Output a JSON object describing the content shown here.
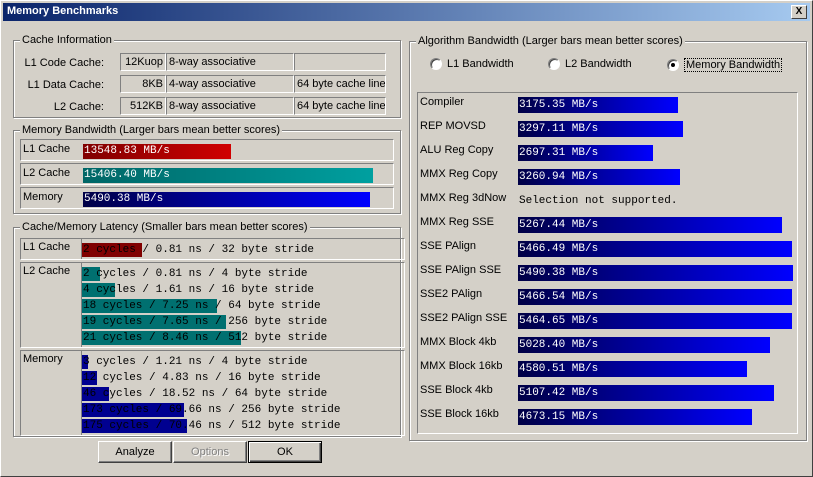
{
  "window": {
    "title": "Memory Benchmarks",
    "close": "X"
  },
  "cache_info": {
    "legend": "Cache Information",
    "rows": [
      {
        "label": "L1 Code Cache:",
        "size": "12Kuop",
        "assoc": "8-way associative",
        "line": ""
      },
      {
        "label": "L1 Data Cache:",
        "size": "8KB",
        "assoc": "4-way associative",
        "line": "64 byte cache line"
      },
      {
        "label": "L2 Cache:",
        "size": "512KB",
        "assoc": "8-way associative",
        "line": "64 byte cache line"
      }
    ]
  },
  "mem_bandwidth": {
    "legend": "Memory Bandwidth (Larger bars mean better scores)",
    "rows": [
      {
        "label": "L1 Cache",
        "value": "13548.83 MB/s",
        "fraction": 0.51,
        "color_from": "#800000",
        "color_to": "#d00000"
      },
      {
        "label": "L2 Cache",
        "value": "15406.40 MB/s",
        "fraction": 1.0,
        "color_from": "#006666",
        "color_to": "#00a0a0"
      },
      {
        "label": "Memory",
        "value": "5490.38 MB/s",
        "fraction": 0.99,
        "color_from": "#000046",
        "color_to": "#0000ff"
      }
    ]
  },
  "latency": {
    "legend": "Cache/Memory Latency (Smaller bars mean better scores)",
    "sections": [
      {
        "label": "L1 Cache",
        "color": "#800000",
        "lines": [
          {
            "text": "2 cycles / 0.81 ns / 32 byte stride",
            "fraction": 0.2
          }
        ]
      },
      {
        "label": "L2 Cache",
        "color": "#007070",
        "lines": [
          {
            "text": "2 cycles / 0.81 ns / 4 byte stride",
            "fraction": 0.06
          },
          {
            "text": "4 cycles / 1.61 ns / 16 byte stride",
            "fraction": 0.11
          },
          {
            "text": "18 cycles / 7.25 ns / 64 byte stride",
            "fraction": 0.45
          },
          {
            "text": "19 cycles / 7.65 ns / 256 byte stride",
            "fraction": 0.48
          },
          {
            "text": "21 cycles / 8.46 ns / 512 byte stride",
            "fraction": 0.53
          }
        ]
      },
      {
        "label": "Memory",
        "color": "#000090",
        "lines": [
          {
            "text": "3 cycles / 1.21 ns / 4 byte stride",
            "fraction": 0.02
          },
          {
            "text": "12 cycles / 4.83 ns / 16 byte stride",
            "fraction": 0.05
          },
          {
            "text": "46 cycles / 18.52 ns / 64 byte stride",
            "fraction": 0.09
          },
          {
            "text": "173 cycles / 69.66 ns / 256 byte stride",
            "fraction": 0.34
          },
          {
            "text": "175 cycles / 70.46 ns / 512 byte stride",
            "fraction": 0.35
          }
        ]
      }
    ]
  },
  "algorithm": {
    "legend": "Algorithm Bandwidth (Larger bars mean better scores)",
    "options": [
      {
        "label": "L1 Bandwidth",
        "selected": false
      },
      {
        "label": "L2 Bandwidth",
        "selected": false
      },
      {
        "label": "Memory Bandwidth",
        "selected": true
      }
    ],
    "rows": [
      {
        "label": "Compiler",
        "value": "3175.35 MB/s",
        "fraction": 0.58
      },
      {
        "label": "REP MOVSD",
        "value": "3297.11 MB/s",
        "fraction": 0.6
      },
      {
        "label": "ALU Reg Copy",
        "value": "2697.31 MB/s",
        "fraction": 0.49
      },
      {
        "label": "MMX Reg Copy",
        "value": "3260.94 MB/s",
        "fraction": 0.59
      },
      {
        "label": "MMX Reg 3dNow",
        "value": "Selection not supported.",
        "fraction": 0
      },
      {
        "label": "MMX Reg SSE",
        "value": "5267.44 MB/s",
        "fraction": 0.96
      },
      {
        "label": "SSE PAlign",
        "value": "5466.49 MB/s",
        "fraction": 0.996
      },
      {
        "label": "SSE PAlign SSE",
        "value": "5490.38 MB/s",
        "fraction": 1.0
      },
      {
        "label": "SSE2 PAlign",
        "value": "5466.54 MB/s",
        "fraction": 0.996
      },
      {
        "label": "SSE2 PAlign SSE",
        "value": "5464.65 MB/s",
        "fraction": 0.995
      },
      {
        "label": "MMX Block 4kb",
        "value": "5028.40 MB/s",
        "fraction": 0.916
      },
      {
        "label": "MMX Block 16kb",
        "value": "4580.51 MB/s",
        "fraction": 0.834
      },
      {
        "label": "SSE Block 4kb",
        "value": "5107.42 MB/s",
        "fraction": 0.93
      },
      {
        "label": "SSE Block 16kb",
        "value": "4673.15 MB/s",
        "fraction": 0.851
      }
    ]
  },
  "buttons": {
    "analyze": "Analyze",
    "options": "Options",
    "ok": "OK"
  }
}
